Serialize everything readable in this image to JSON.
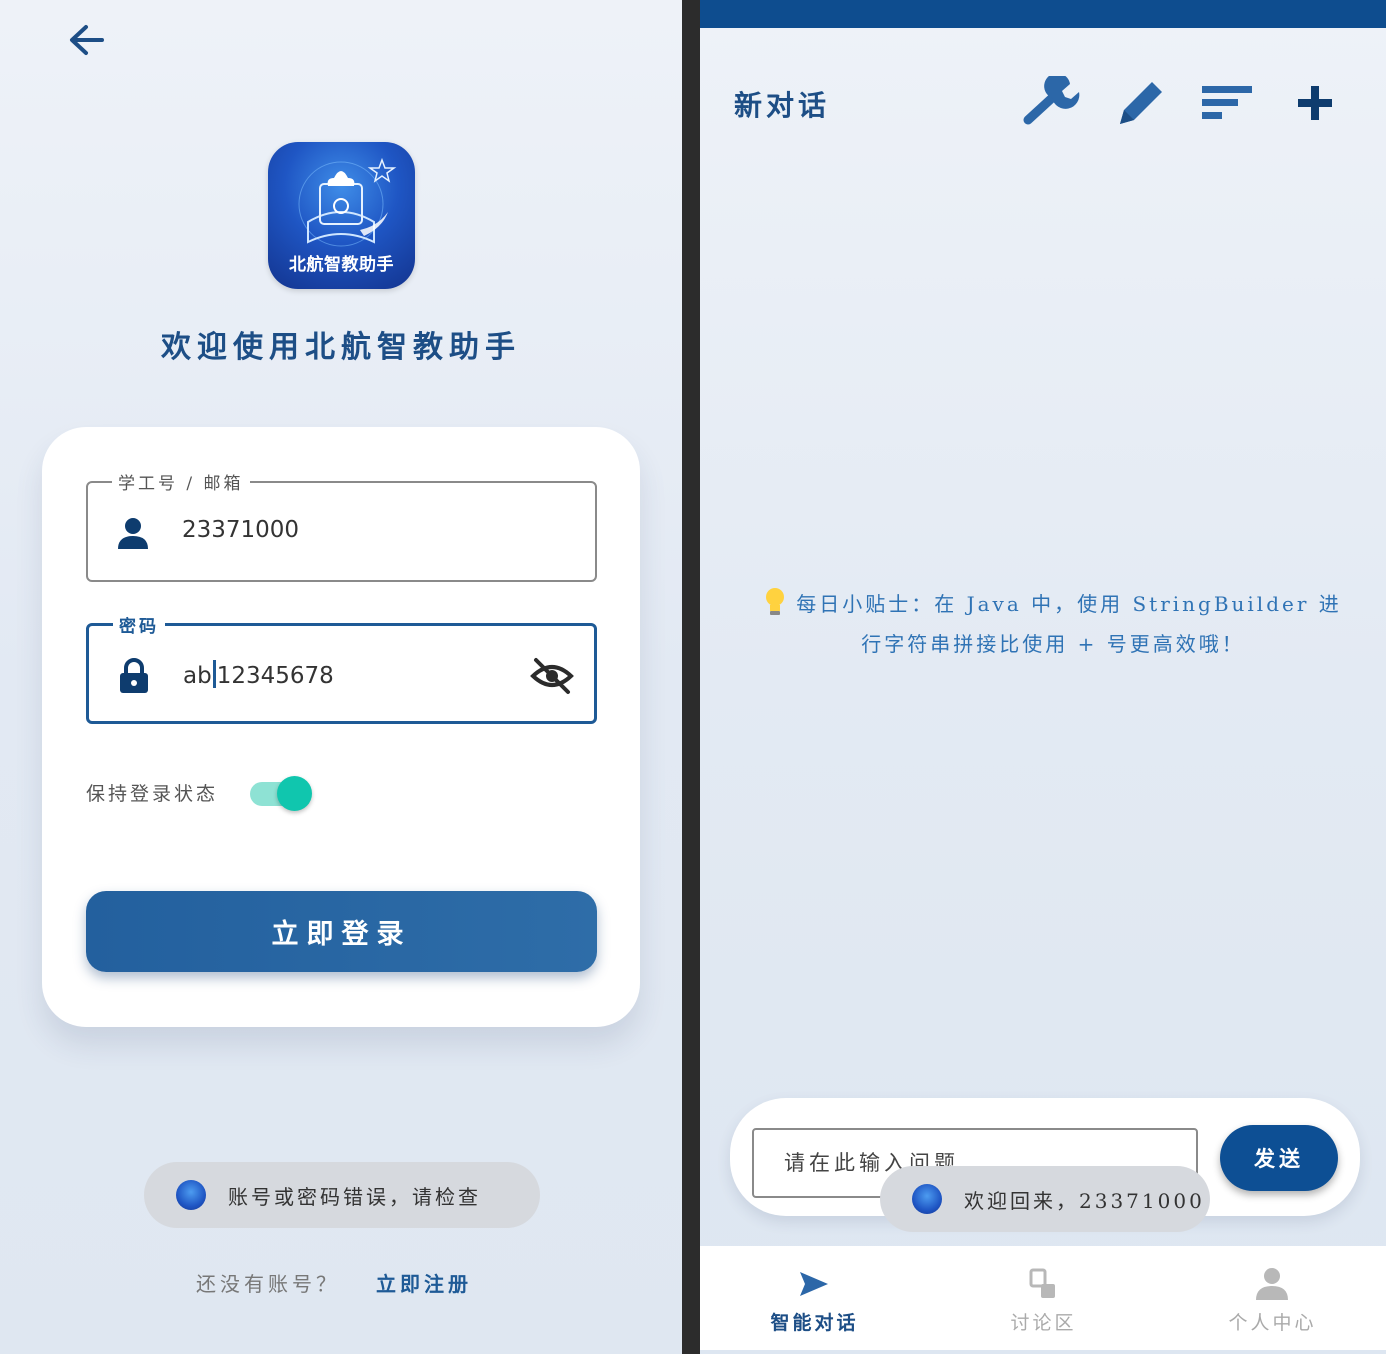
{
  "login": {
    "logo_text": "北航智教助手",
    "welcome_title": "欢迎使用北航智教助手",
    "username": {
      "label": "学工号 / 邮箱",
      "value": "23371000"
    },
    "password": {
      "label": "密码",
      "value_before_caret": "ab",
      "value_after_caret": "12345678"
    },
    "remember_label": "保持登录状态",
    "remember_on": true,
    "login_button": "立即登录",
    "error_toast": "账号或密码错误，请检查",
    "register_prompt": "还没有账号？",
    "register_link": "立即注册"
  },
  "chat": {
    "title": "新对话",
    "toolbar_icons": [
      "wrench-icon",
      "pencil-icon",
      "sort-icon",
      "plus-icon"
    ],
    "tip_line1": "每日小贴士：在 Java 中，使用 StringBuilder 进",
    "tip_line2": "行字符串拼接比使用 + 号更高效哦！",
    "input_placeholder": "请在此输入问题",
    "send_button": "发送",
    "welcome_toast": "欢迎回来，23371000",
    "nav": [
      {
        "label": "智能对话",
        "icon": "send-icon",
        "active": true
      },
      {
        "label": "讨论区",
        "icon": "forum-icon",
        "active": false
      },
      {
        "label": "个人中心",
        "icon": "person-icon",
        "active": false
      }
    ]
  },
  "colors": {
    "primary": "#1d4e86",
    "statusbar": "#0e4d8f",
    "toggle_on": "#10c6ae",
    "tip_text": "#2f73b5"
  }
}
